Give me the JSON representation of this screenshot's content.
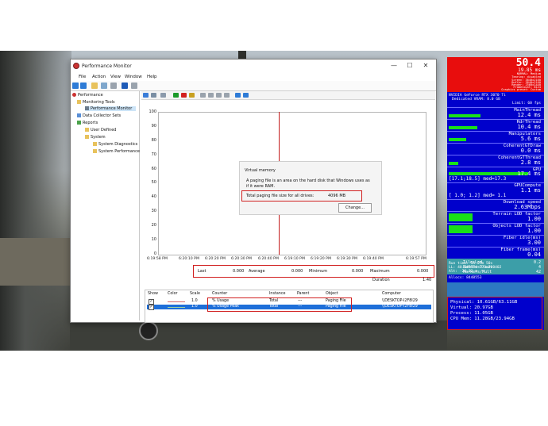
{
  "window": {
    "title": "Performance Monitor",
    "controls": {
      "minimize": "—",
      "maximize": "☐",
      "close": "✕"
    }
  },
  "menu": [
    "File",
    "Action",
    "View",
    "Window",
    "Help"
  ],
  "tree": {
    "root": "Performance",
    "items": [
      {
        "label": "Monitoring Tools",
        "depth": 1
      },
      {
        "label": "Performance Monitor",
        "depth": 2
      },
      {
        "label": "Data Collector Sets",
        "depth": 1
      },
      {
        "label": "Reports",
        "depth": 1
      },
      {
        "label": "User Defined",
        "depth": 2
      },
      {
        "label": "System",
        "depth": 2
      },
      {
        "label": "System Diagnostics",
        "depth": 3
      },
      {
        "label": "System Performance",
        "depth": 3
      }
    ]
  },
  "chart": {
    "y_ticks": [
      "100",
      "90",
      "80",
      "70",
      "60",
      "50",
      "40",
      "30",
      "20",
      "10",
      "0"
    ],
    "x_ticks": [
      "6:19:58 PM",
      "6:20:10 PM",
      "6:20:20 PM",
      "6:20:30 PM",
      "6:20:40 PM",
      "6:19:10 PM",
      "6:19:20 PM",
      "6:19:30 PM",
      "6:19:40 PM",
      "6:19:57 PM"
    ]
  },
  "virtual_memory": {
    "title": "Virtual memory",
    "desc_line1": "A paging file is an area on the hard disk that Windows uses as",
    "desc_line2": "if it were RAM.",
    "total_label": "Total paging file size for all drives:",
    "total_value": "4096 MB",
    "change_button": "Change..."
  },
  "stats": {
    "last_label": "Last",
    "last_value": "0.000",
    "avg_label": "Average",
    "avg_value": "0.000",
    "min_label": "Minimum",
    "min_value": "0.000",
    "max_label": "Maximum",
    "max_value": "0.000",
    "duration_label": "Duration",
    "duration_value": "1:40"
  },
  "legend": {
    "headers": [
      "Show",
      "Color",
      "Scale",
      "Counter",
      "Instance",
      "Parent",
      "Object",
      "Computer"
    ],
    "rows": [
      {
        "scale": "1.0",
        "counter": "% Usage",
        "instance": "Total",
        "parent": "---",
        "object": "Paging File",
        "computer": "\\\\DESKTOP-I2F8I29",
        "color": "#d66a6a"
      },
      {
        "scale": "1.0",
        "counter": "% Usage Peak",
        "instance": "Total",
        "parent": "---",
        "object": "Paging File",
        "computer": "\\\\DESKTOP-I2F8I29",
        "color": "#5a9a5a"
      }
    ]
  },
  "overlay": {
    "fps": "50.4",
    "frametime": "19.85 ms",
    "header_lines": [
      "NORMAL: Medium",
      "Tearing: disabled",
      "Screen: 3840x2160",
      "Buffer: 3840x2160",
      "Render: 2560x1440",
      "FrameCount: 8124",
      "Graphics preset: Custom"
    ],
    "gpu_lines": [
      "NVIDIA GeForce RTX 3070 Ti",
      "Dedicated VRAM: 8.0 GB",
      "Limit: 60 fps"
    ],
    "metrics": [
      {
        "label": "MainThread",
        "value": "12.4 ms"
      },
      {
        "label": "RdrThread",
        "value": "10.4 ms"
      },
      {
        "label": "Manipulators",
        "value": "5.6 ms"
      },
      {
        "label": "CoherentGTDraw",
        "value": "0.0 ms"
      },
      {
        "label": "CoherentGTThread",
        "value": "2.8 ms"
      },
      {
        "label": "GPU",
        "value": "17.4 ms"
      }
    ],
    "gpu_range": "[17.1;18.5]  med=17.3",
    "gpu_compute_label": "GPUCompute",
    "gpu_compute_value": "1.1 ms",
    "gpu_compute_range": "[ 1.0; 1.2]  med= 1.1",
    "download_label": "Download speed",
    "download_value": "2.63Mbps",
    "terrain_lod_label": "Terrain LOD factor",
    "terrain_lod_value": "1.00",
    "objects_lod_label": "Objects LOD factor",
    "objects_lod_value": "1.00",
    "fiber_label": "Fiber idle(ms)",
    "fiber_value": "3.00",
    "fiber_frame_label": "Fiber frame(ms)",
    "fiber_frame_value": "0.04",
    "tile_label": "TilesLod",
    "tile_value": "0.2",
    "batches_label": "BatchesDrawn",
    "batches_value": "4",
    "markers_label": "Markers/Mult",
    "markers_value": "42",
    "info_lines": [
      "Run time: 1h 27m 50s",
      "LL: 40.648574 -73.780402",
      "Alt: -26.23 m",
      "Allocs: 8448553"
    ],
    "mem_lines": [
      "Physical: 10.61GB/63.11GB",
      "Virtual: 20.97GB",
      "Process: 11.05GB",
      "CPU Mem: 11.28GB/23.94GB"
    ]
  }
}
